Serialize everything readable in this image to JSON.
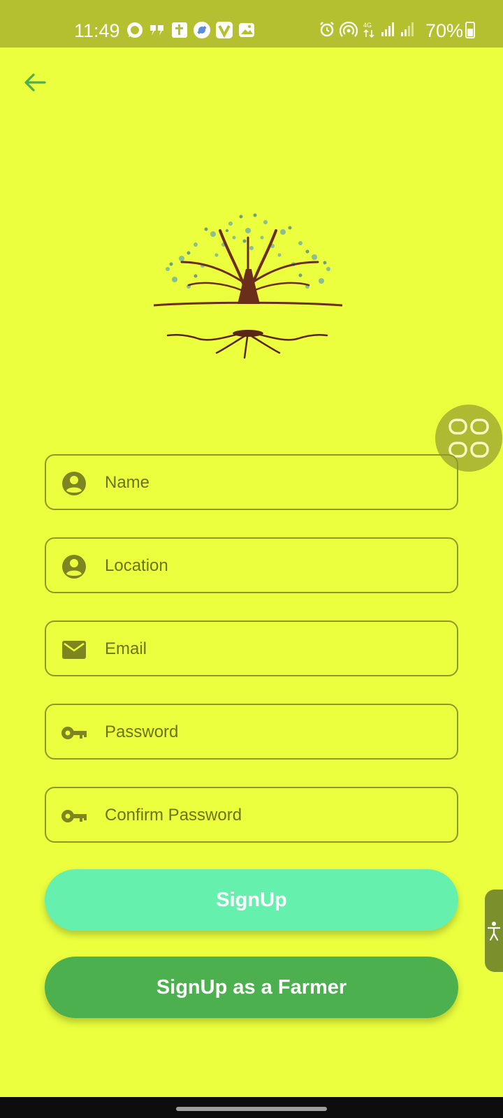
{
  "status_bar": {
    "time": "11:49",
    "battery": "70%",
    "notification_icons": [
      "whatsapp-icon",
      "quote-icon",
      "bible-app-icon",
      "satellite-app-icon",
      "v-app-icon",
      "gallery-icon"
    ],
    "system_icons": [
      "alarm-icon",
      "hotspot-icon",
      "4g-data-icon",
      "signal-icon",
      "signal-icon",
      "battery-icon"
    ]
  },
  "colors": {
    "background": "#ebff3f",
    "status_bar": "#b5c030",
    "field_border": "#8c9a28",
    "field_text": "#6b7418",
    "signup_button": "#66f0ae",
    "farmer_button": "#4cb04e",
    "back_arrow": "#4cb04e"
  },
  "form": {
    "name_placeholder": "Name",
    "location_placeholder": "Location",
    "email_placeholder": "Email",
    "password_placeholder": "Password",
    "confirm_password_placeholder": "Confirm Password"
  },
  "buttons": {
    "signup": "SignUp",
    "signup_farmer": "SignUp as a Farmer"
  }
}
